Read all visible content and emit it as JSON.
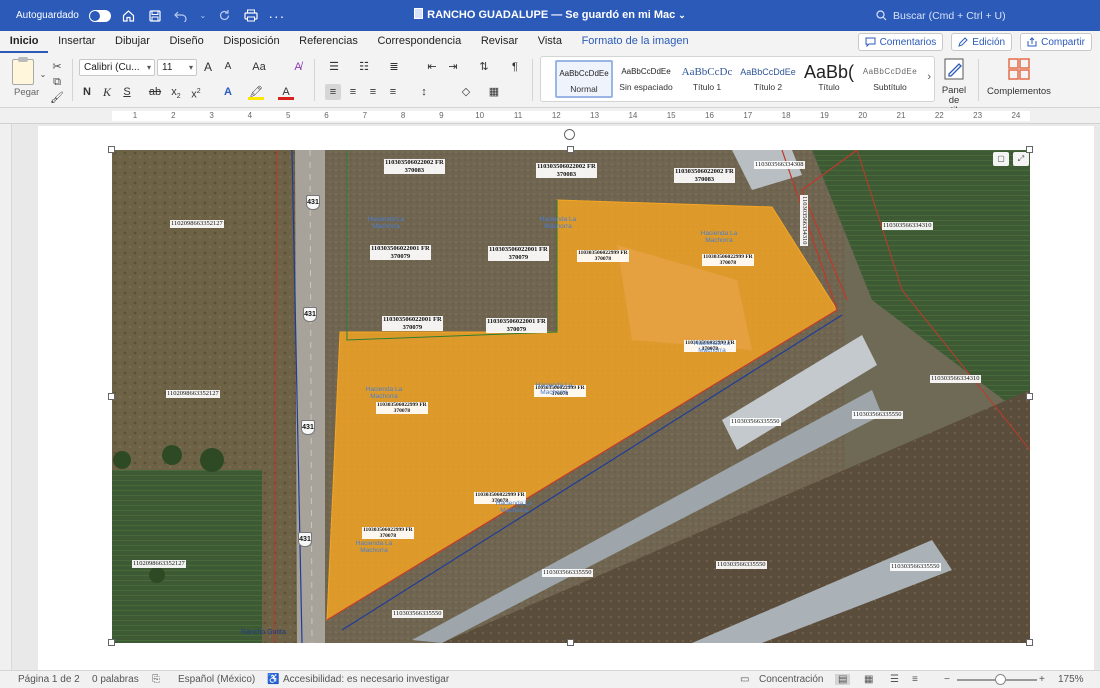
{
  "titlebar": {
    "autosave_label": "Autoguardado",
    "document_title": "RANCHO GUADALUPE — Se guardó en mi Mac",
    "search_placeholder": "Buscar (Cmd + Ctrl + U)"
  },
  "menu": {
    "tabs": [
      {
        "label": "Inicio",
        "active": true
      },
      {
        "label": "Insertar"
      },
      {
        "label": "Dibujar"
      },
      {
        "label": "Diseño"
      },
      {
        "label": "Disposición"
      },
      {
        "label": "Referencias"
      },
      {
        "label": "Correspondencia"
      },
      {
        "label": "Revisar"
      },
      {
        "label": "Vista"
      },
      {
        "label": "Formato de la imagen",
        "contextual": true
      }
    ],
    "comments_label": "Comentarios",
    "editing_label": "Edición",
    "share_label": "Compartir"
  },
  "ribbon": {
    "paste_label": "Pegar",
    "font_name": "Calibri (Cu...",
    "font_size": "11",
    "grow_font": "A",
    "shrink_font": "A",
    "change_case": "Aa",
    "bold": "N",
    "italic": "K",
    "underline": "S",
    "strikethrough": "ab",
    "subscript": "x",
    "superscript": "x",
    "subscript_mark": "2",
    "superscript_mark": "2",
    "text_effects": "A",
    "font_color": "A",
    "pilcrow": "¶",
    "styles": [
      {
        "sample": "AaBbCcDdEe",
        "name": "Normal",
        "active": true
      },
      {
        "sample": "AaBbCcDdEe",
        "name": "Sin espaciado"
      },
      {
        "sample": "AaBbCcDc",
        "name": "Título 1"
      },
      {
        "sample": "AaBbCcDdEe",
        "name": "Título 2"
      },
      {
        "sample": "AaBb(",
        "name": "Título"
      },
      {
        "sample": "AaBbCcDdEe",
        "name": "Subtítulo"
      }
    ],
    "styles_pane_label": "Panel de estilos",
    "addins_label": "Complementos"
  },
  "ruler": {
    "numbers": [
      "1",
      "2",
      "3",
      "4",
      "5",
      "6",
      "7",
      "8",
      "9",
      "10",
      "11",
      "12",
      "13",
      "14",
      "15",
      "16",
      "17",
      "18",
      "19",
      "20",
      "21",
      "22",
      "23",
      "24"
    ]
  },
  "map": {
    "routes": [
      "431",
      "431",
      "431",
      "431"
    ],
    "cadastral_labels": [
      "1102098663352127",
      "1102098663352127",
      "1102098663352127",
      "110303566334308",
      "110303566334310",
      "110303566334310",
      "110303566334310",
      "110303566335550",
      "110303566335550",
      "110303566335550",
      "110303566335550",
      "110303566335550",
      "110303566335550",
      "110303566335550"
    ],
    "parcel_labels": [
      {
        "code": "110303506022002 FR",
        "sub": "370083"
      },
      {
        "code": "110303506022002 FR",
        "sub": "370083"
      },
      {
        "code": "110303506022002 FR",
        "sub": "370083"
      },
      {
        "code": "110303506022001 FR",
        "sub": "370079"
      },
      {
        "code": "110303506022001 FR",
        "sub": "370079"
      },
      {
        "code": "110303506022001 FR",
        "sub": "370079"
      },
      {
        "code": "110303506022001 FR",
        "sub": "370079"
      },
      {
        "code": "110303506022999 FR",
        "sub": "370078"
      },
      {
        "code": "110303506022999 FR",
        "sub": "370078"
      },
      {
        "code": "110303506022999 FR",
        "sub": "370078"
      },
      {
        "code": "110303506022999 FR",
        "sub": "370078"
      },
      {
        "code": "110303506022999 FR",
        "sub": "370078"
      },
      {
        "code": "110303506022999 FR",
        "sub": "370078"
      },
      {
        "code": "110303506022999 FR",
        "sub": "370078"
      }
    ],
    "hacienda_label": "Hacienda La Machorra",
    "credit": "Rancho Gotita"
  },
  "status": {
    "page": "Página 1 de 2",
    "words": "0 palabras",
    "language": "Español (México)",
    "accessibility": "Accesibilidad: es necesario investigar",
    "focus": "Concentración",
    "zoom": "175%"
  },
  "colors": {
    "titlebar": "#2b5ab9",
    "parcel_fill": "#f5a623",
    "boundary_red": "#c0392b",
    "road_blue": "#1f3c9a"
  }
}
